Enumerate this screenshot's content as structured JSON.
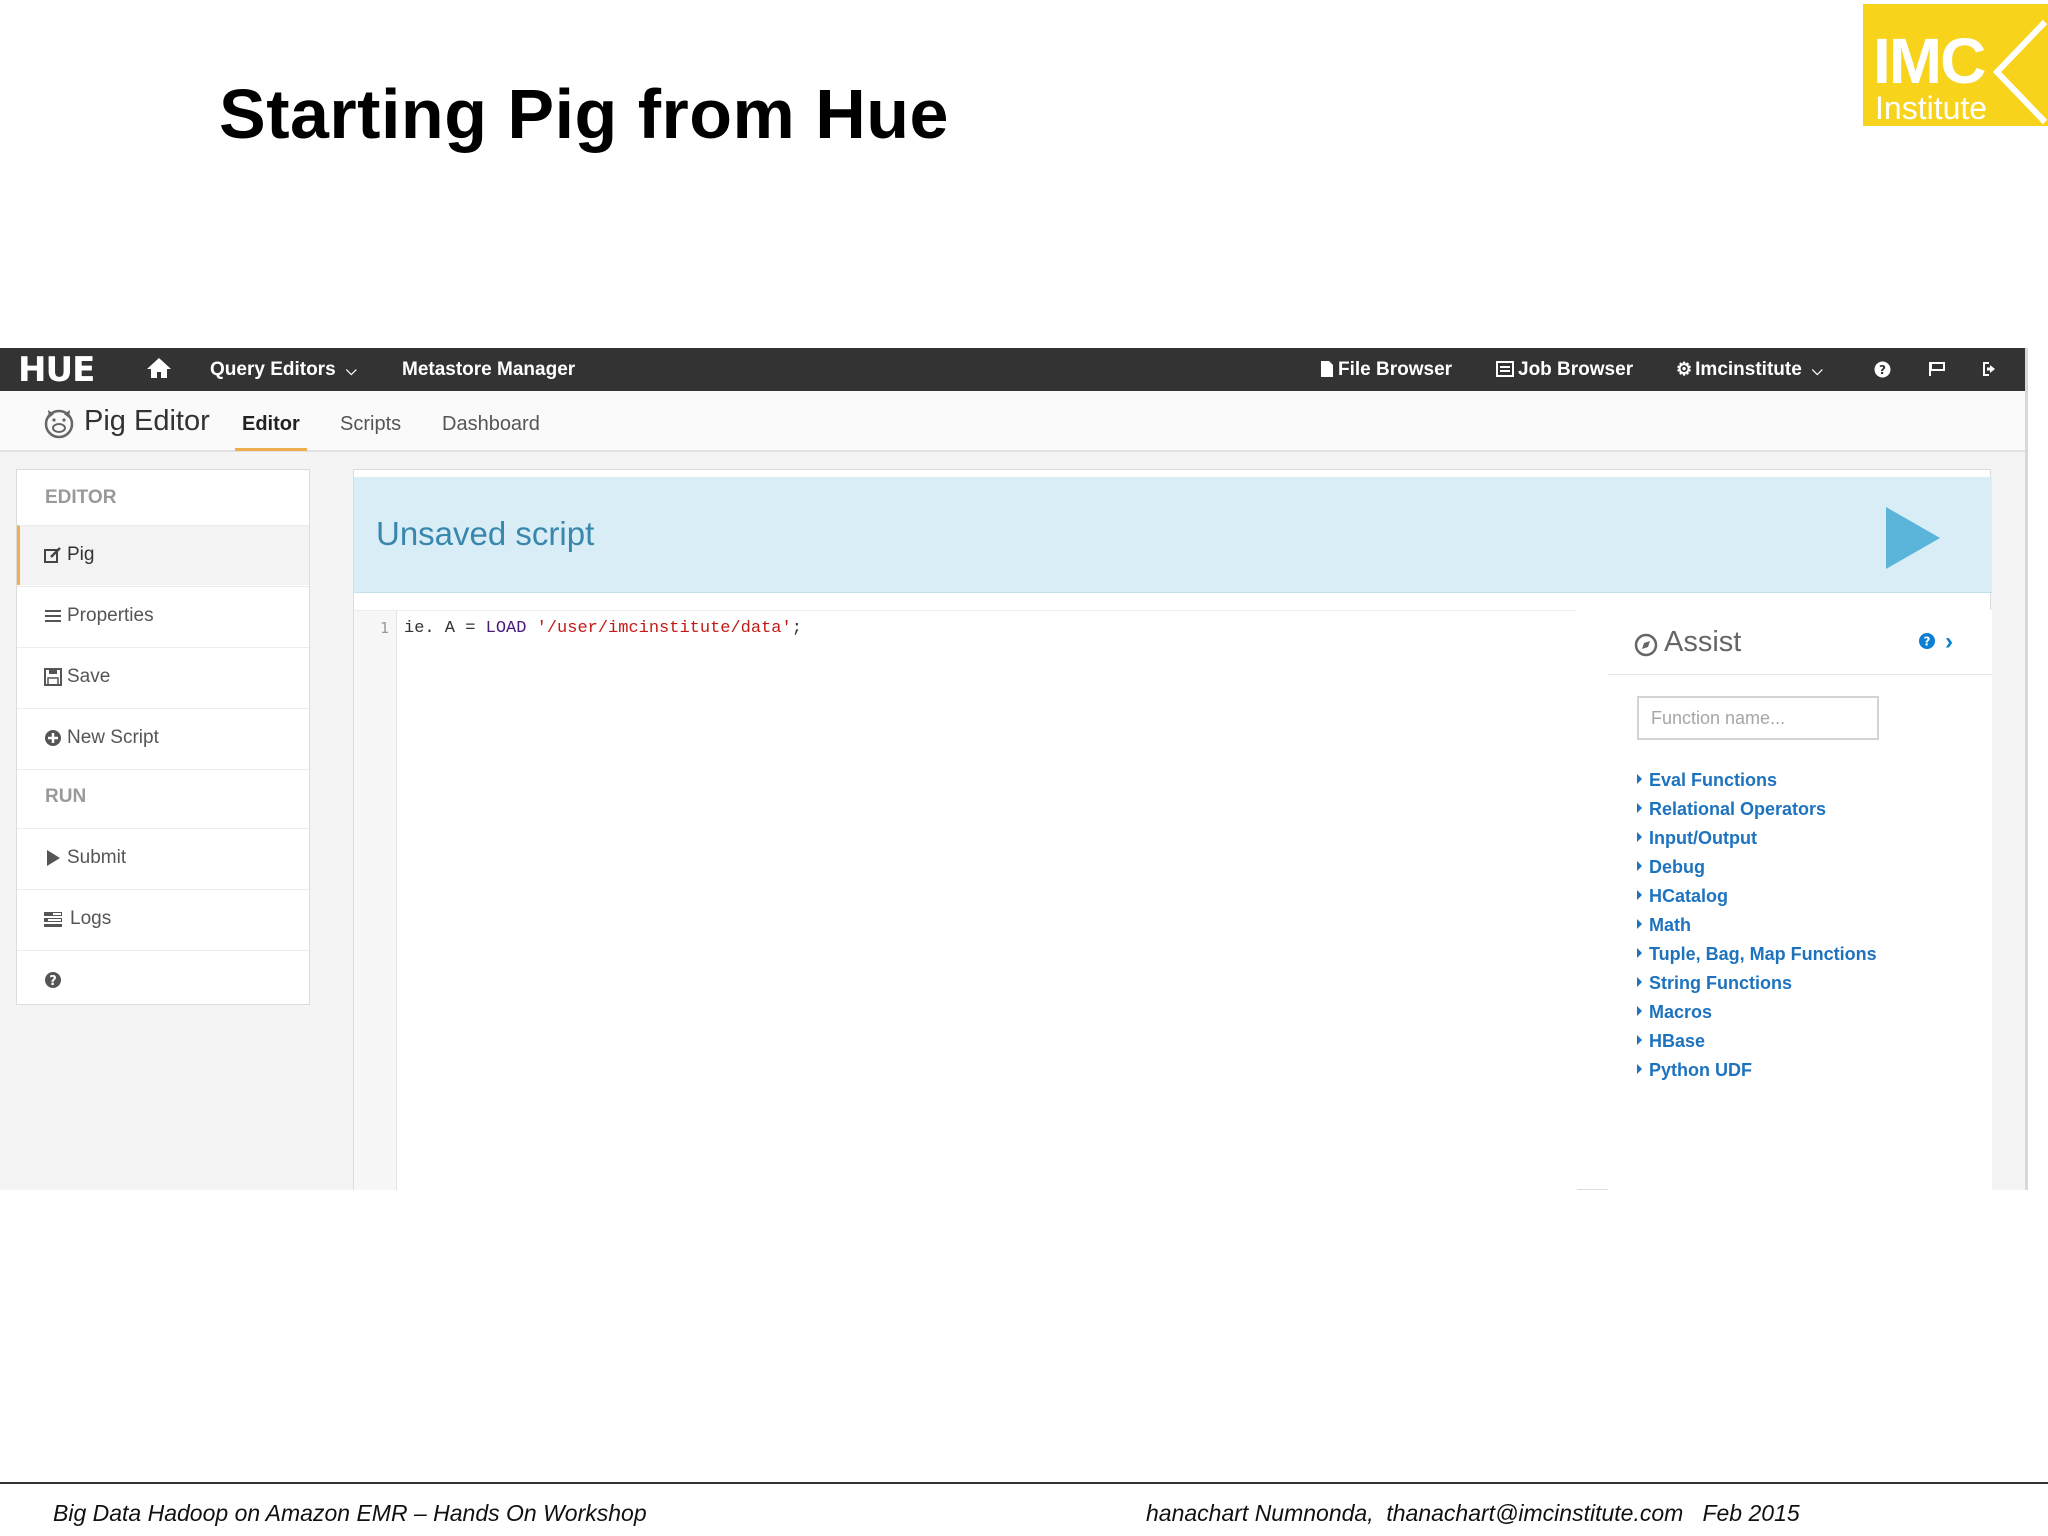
{
  "slide": {
    "title": "Starting Pig from Hue",
    "logo_text": "IMC",
    "logo_subtext": "Institute",
    "footer_left": "Big Data Hadoop on Amazon EMR – Hands On Workshop",
    "footer_right": "hanachart Numnonda,  thanachart@imcinstitute.com   Feb 2015"
  },
  "navbar": {
    "logo": "HUE",
    "home_icon": "home-icon",
    "query_editors": "Query Editors",
    "metastore": "Metastore Manager",
    "file_browser": "File Browser",
    "job_browser": "Job Browser",
    "user": "Imcinstitute"
  },
  "subnav": {
    "app_name": "Pig Editor",
    "tabs": [
      "Editor",
      "Scripts",
      "Dashboard"
    ],
    "active_tab": "Editor"
  },
  "sidebar": {
    "section_editor": "EDITOR",
    "section_run": "RUN",
    "items": [
      {
        "label": "Pig",
        "icon": "edit-icon"
      },
      {
        "label": "Properties",
        "icon": "list-icon"
      },
      {
        "label": "Save",
        "icon": "save-icon"
      },
      {
        "label": "New Script",
        "icon": "plus-circle-icon"
      },
      {
        "label": "Submit",
        "icon": "play-icon"
      },
      {
        "label": "Logs",
        "icon": "tasks-icon"
      }
    ]
  },
  "main": {
    "script_title": "Unsaved script",
    "line_number": "1",
    "code": {
      "prefix": "ie. A = ",
      "keyword": "LOAD",
      "string": "'/user/imcinstitute/data'",
      "suffix": ";"
    }
  },
  "assist": {
    "title": "Assist",
    "search_placeholder": "Function name...",
    "functions": [
      "Eval Functions",
      "Relational Operators",
      "Input/Output",
      "Debug",
      "HCatalog",
      "Math",
      "Tuple, Bag, Map Functions",
      "String Functions",
      "Macros",
      "HBase",
      "Python UDF"
    ]
  },
  "colors": {
    "navbar": "#333333",
    "accent": "#f0ad4e",
    "header_bg": "#d9edf7",
    "link": "#1e73be",
    "logo_bg": "#f7d31c"
  }
}
